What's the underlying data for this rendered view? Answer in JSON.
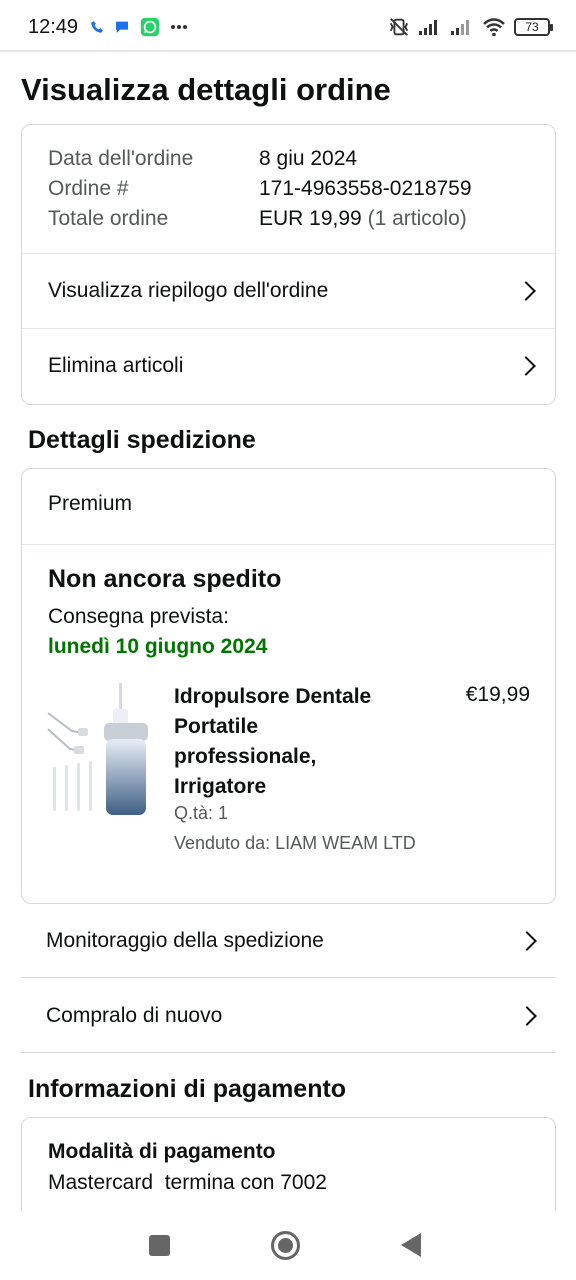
{
  "status_bar": {
    "time": "12:49",
    "battery": "73",
    "notification_icons": [
      "phone-icon",
      "chat-bubble-icon",
      "whatsapp-icon",
      "more-dots-icon"
    ],
    "system_icons": [
      "vibrate-off-icon",
      "signal-icon",
      "signal-icon",
      "wifi-icon",
      "battery-icon"
    ]
  },
  "page": {
    "title": "Visualizza dettagli ordine"
  },
  "order_summary": {
    "date_label": "Data dell'ordine",
    "date_value": "8 giu 2024",
    "number_label": "Ordine #",
    "number_value": "171-4963558-0218759",
    "total_label": "Totale ordine",
    "total_value": "EUR 19,99",
    "total_count": "(1 articolo)",
    "view_summary_link": "Visualizza riepilogo dell'ordine",
    "delete_items_link": "Elimina articoli"
  },
  "shipping": {
    "section_title": "Dettagli spedizione",
    "service": "Premium",
    "status": "Non ancora spedito",
    "delivery_label": "Consegna prevista:",
    "delivery_date": "lunedì 10 giugno 2024",
    "item": {
      "title_line1": "Idropulsore Dentale",
      "title_line2": "Portatile",
      "title_line3": "professionale,",
      "title_line4": "Irrigatore",
      "price": "€19,99",
      "qty": "Q.tà: 1",
      "seller": "Venduto da: LIAM WEAM LTD"
    },
    "track_link": "Monitoraggio della spedizione",
    "buy_again_link": "Compralo di nuovo"
  },
  "payment": {
    "section_title": "Informazioni di pagamento",
    "method_label": "Modalità di pagamento",
    "method_value": "Mastercard  termina con 7002"
  },
  "colors": {
    "delivery_green": "#007600",
    "text": "#0f1111",
    "muted": "#565959",
    "border": "#d5d9d9"
  }
}
